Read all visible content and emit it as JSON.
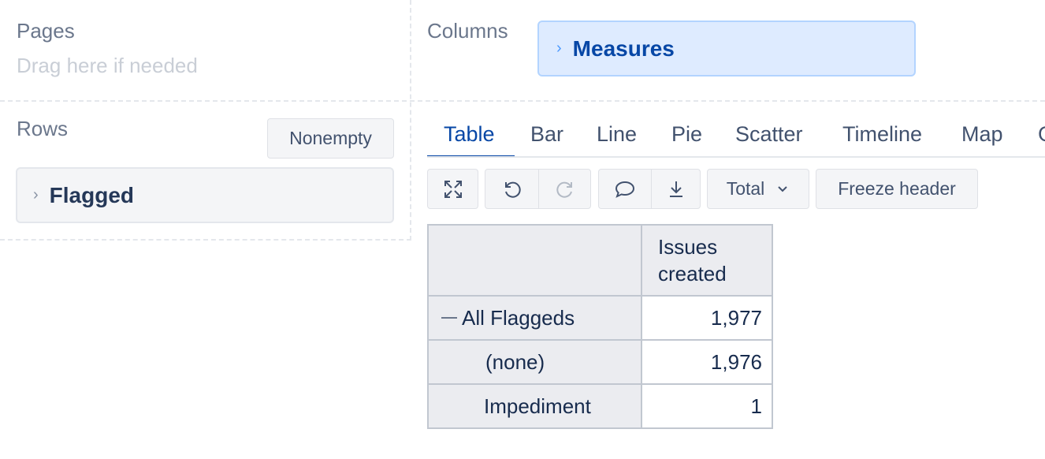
{
  "pages": {
    "title": "Pages",
    "hint": "Drag here if needed"
  },
  "columns": {
    "title": "Columns",
    "chip": "Measures"
  },
  "rows": {
    "title": "Rows",
    "nonempty_label": "Nonempty",
    "chip": "Flagged"
  },
  "tabs": [
    "Table",
    "Bar",
    "Line",
    "Pie",
    "Scatter",
    "Timeline",
    "Map",
    "Gantt"
  ],
  "active_tab": "Table",
  "toolbar": {
    "expand_icon": "expand-icon",
    "undo_icon": "undo-icon",
    "redo_icon": "redo-icon",
    "comment_icon": "comment-icon",
    "download_icon": "download-icon",
    "total_label": "Total",
    "freeze_label": "Freeze header"
  },
  "table": {
    "column_header": "Issues created",
    "rows": [
      {
        "label": "All Flaggeds",
        "value": "1,977",
        "collapse_icon": "minus-icon"
      },
      {
        "label": "(none)",
        "value": "1,976"
      },
      {
        "label": "Impediment",
        "value": "1"
      }
    ]
  },
  "colors": {
    "accent": "#0747a6",
    "chip_bg": "#deebff",
    "panel_bg": "#f4f5f7"
  }
}
